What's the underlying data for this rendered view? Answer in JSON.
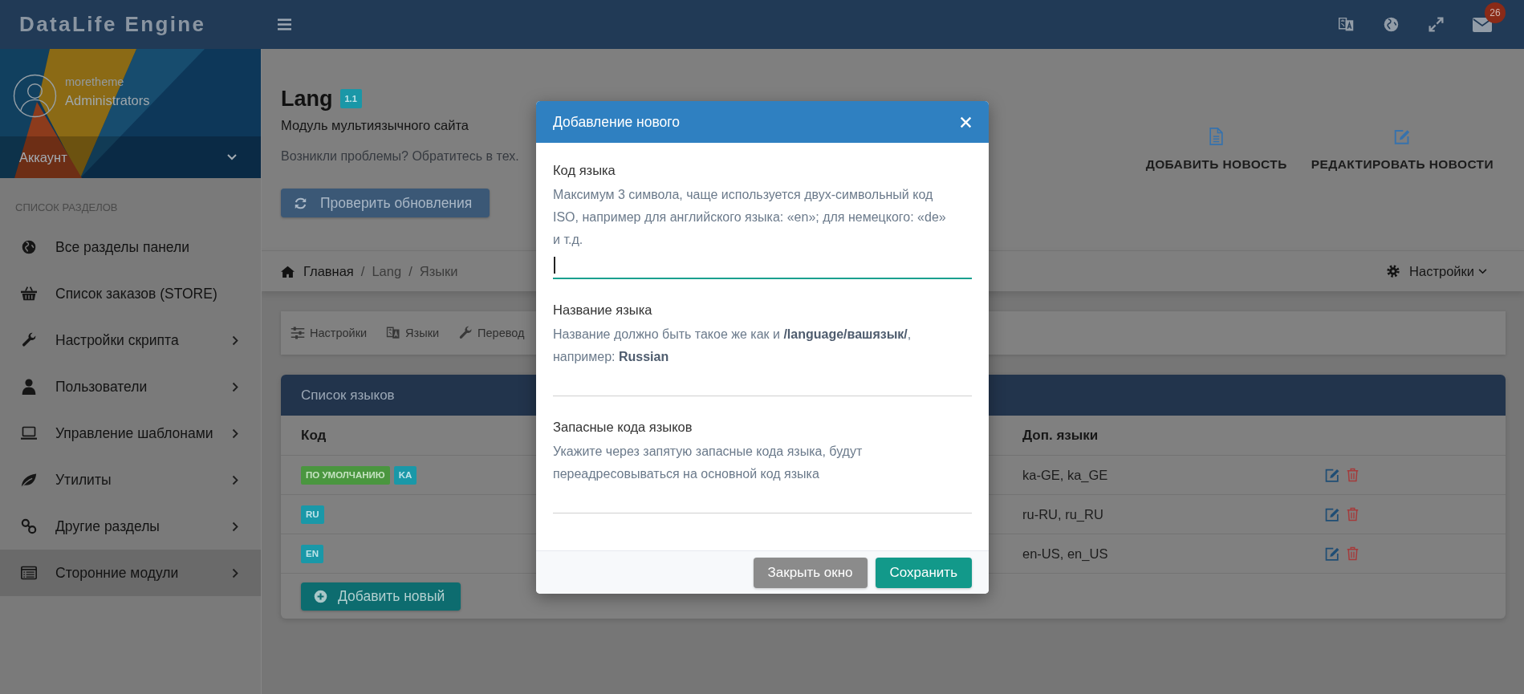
{
  "header": {
    "logo": "DataLife Engine",
    "notification_count": "26"
  },
  "sidebar": {
    "profile": {
      "username": "moretheme",
      "role": "Administrators",
      "account_label": "Аккаунт"
    },
    "section_title": "СПИСОК РАЗДЕЛОВ",
    "items": [
      {
        "label": "Все разделы панели",
        "expandable": false,
        "selected": false
      },
      {
        "label": "Список заказов (STORE)",
        "expandable": false,
        "selected": false
      },
      {
        "label": "Настройки скрипта",
        "expandable": true,
        "selected": false
      },
      {
        "label": "Пользователи",
        "expandable": true,
        "selected": false
      },
      {
        "label": "Управление шаблонами",
        "expandable": true,
        "selected": false
      },
      {
        "label": "Утилиты",
        "expandable": true,
        "selected": false
      },
      {
        "label": "Другие разделы",
        "expandable": true,
        "selected": false
      },
      {
        "label": "Сторонние модули",
        "expandable": true,
        "selected": true
      }
    ]
  },
  "page": {
    "title": "Lang",
    "version": "1.1",
    "subtitle": "Модуль мультиязычного сайта",
    "help_text": "Возникли проблемы? Обратитесь в тех.",
    "update_button": "Проверить обновления",
    "quick_actions": [
      {
        "label": "ДОБАВИТЬ НОВОСТЬ"
      },
      {
        "label": "РЕДАКТИРОВАТЬ НОВОСТИ"
      }
    ]
  },
  "breadcrumb": {
    "separator": "/",
    "items": [
      "Главная",
      "Lang",
      "Языки"
    ],
    "settings_menu": "Настройки"
  },
  "toolbar": [
    "Настройки",
    "Языки",
    "Перевод"
  ],
  "table": {
    "title": "Список языков",
    "columns": [
      "Код",
      "Доп. языки"
    ],
    "rows": [
      {
        "tags": [
          {
            "text": "ПО УМОЛЧАНИЮ",
            "kind": "default"
          },
          {
            "text": "KA",
            "kind": "code"
          }
        ],
        "extra_codes": "ka-GE, ka_GE"
      },
      {
        "tags": [
          {
            "text": "RU",
            "kind": "code"
          }
        ],
        "extra_codes": "ru-RU, ru_RU"
      },
      {
        "tags": [
          {
            "text": "EN",
            "kind": "code"
          }
        ],
        "extra_codes": "en-US, en_US"
      }
    ],
    "add_button": "Добавить новый"
  },
  "modal": {
    "title": "Добавление нового",
    "fields": [
      {
        "label": "Код языка",
        "help": "Максимум 3 символа, чаще используется двух-символьный код ISO, например для английского языка: «en»; для немецкого: «de» и т.д.",
        "focused": true
      },
      {
        "label": "Название языка",
        "help": "Название должно быть такое же как и **/language/вашязык/**, например: **Russian**",
        "focused": false
      },
      {
        "label": "Запасные кода языков",
        "help": "Укажите через запятую запасные кода языка, будут переадресовываться на основной код языка",
        "focused": false
      }
    ],
    "buttons": [
      {
        "label": "Закрыть окно",
        "kind": "secondary"
      },
      {
        "label": "Сохранить",
        "kind": "primary"
      }
    ]
  }
}
